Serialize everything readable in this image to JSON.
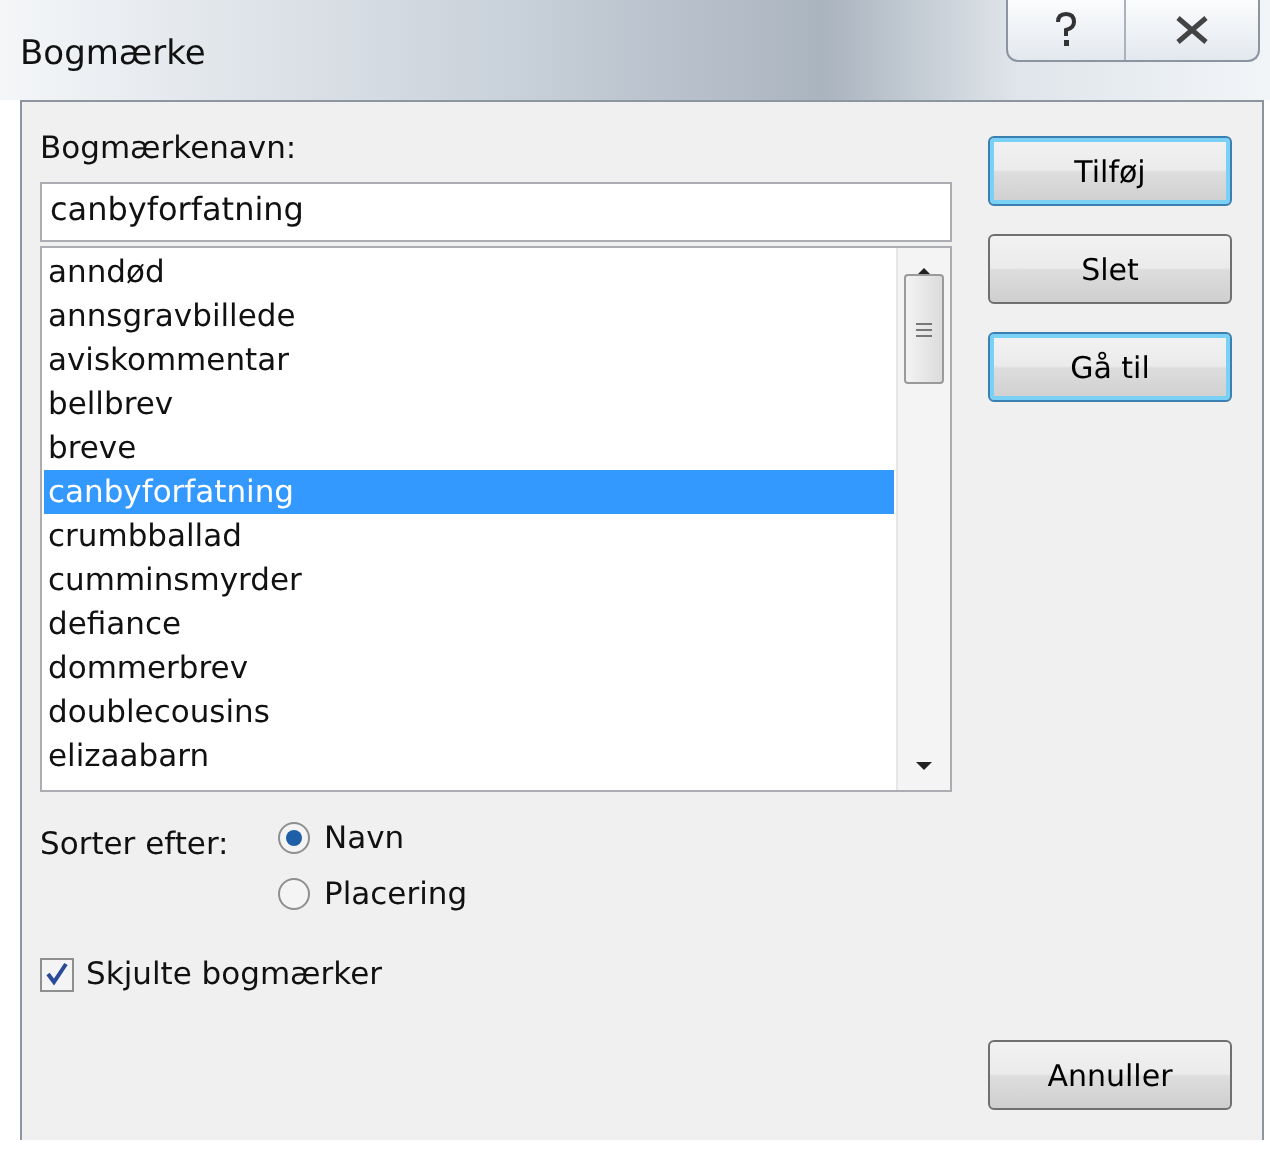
{
  "window": {
    "title": "Bogmærke"
  },
  "name_field": {
    "label": "Bogmærkenavn:",
    "value": "canbyforfatning"
  },
  "bookmarks": [
    {
      "label": "anndød",
      "selected": false
    },
    {
      "label": "annsgravbillede",
      "selected": false
    },
    {
      "label": "aviskommentar",
      "selected": false
    },
    {
      "label": "bellbrev",
      "selected": false
    },
    {
      "label": "breve",
      "selected": false
    },
    {
      "label": "canbyforfatning",
      "selected": true
    },
    {
      "label": "crumbballad",
      "selected": false
    },
    {
      "label": "cumminsmyrder",
      "selected": false
    },
    {
      "label": "defiance",
      "selected": false
    },
    {
      "label": "dommerbrev",
      "selected": false
    },
    {
      "label": "doublecousins",
      "selected": false
    },
    {
      "label": "elizaabarn",
      "selected": false
    }
  ],
  "side_buttons": [
    {
      "label": "Tilføj",
      "focused": true
    },
    {
      "label": "Slet",
      "focused": false
    },
    {
      "label": "Gå til",
      "focused": true
    }
  ],
  "sort": {
    "label": "Sorter efter:",
    "options": [
      {
        "label": "Navn",
        "selected": true
      },
      {
        "label": "Placering",
        "selected": false
      }
    ]
  },
  "hidden_bookmarks": {
    "label": "Skjulte bogmærker",
    "checked": true
  },
  "cancel_button": {
    "label": "Annuller"
  }
}
